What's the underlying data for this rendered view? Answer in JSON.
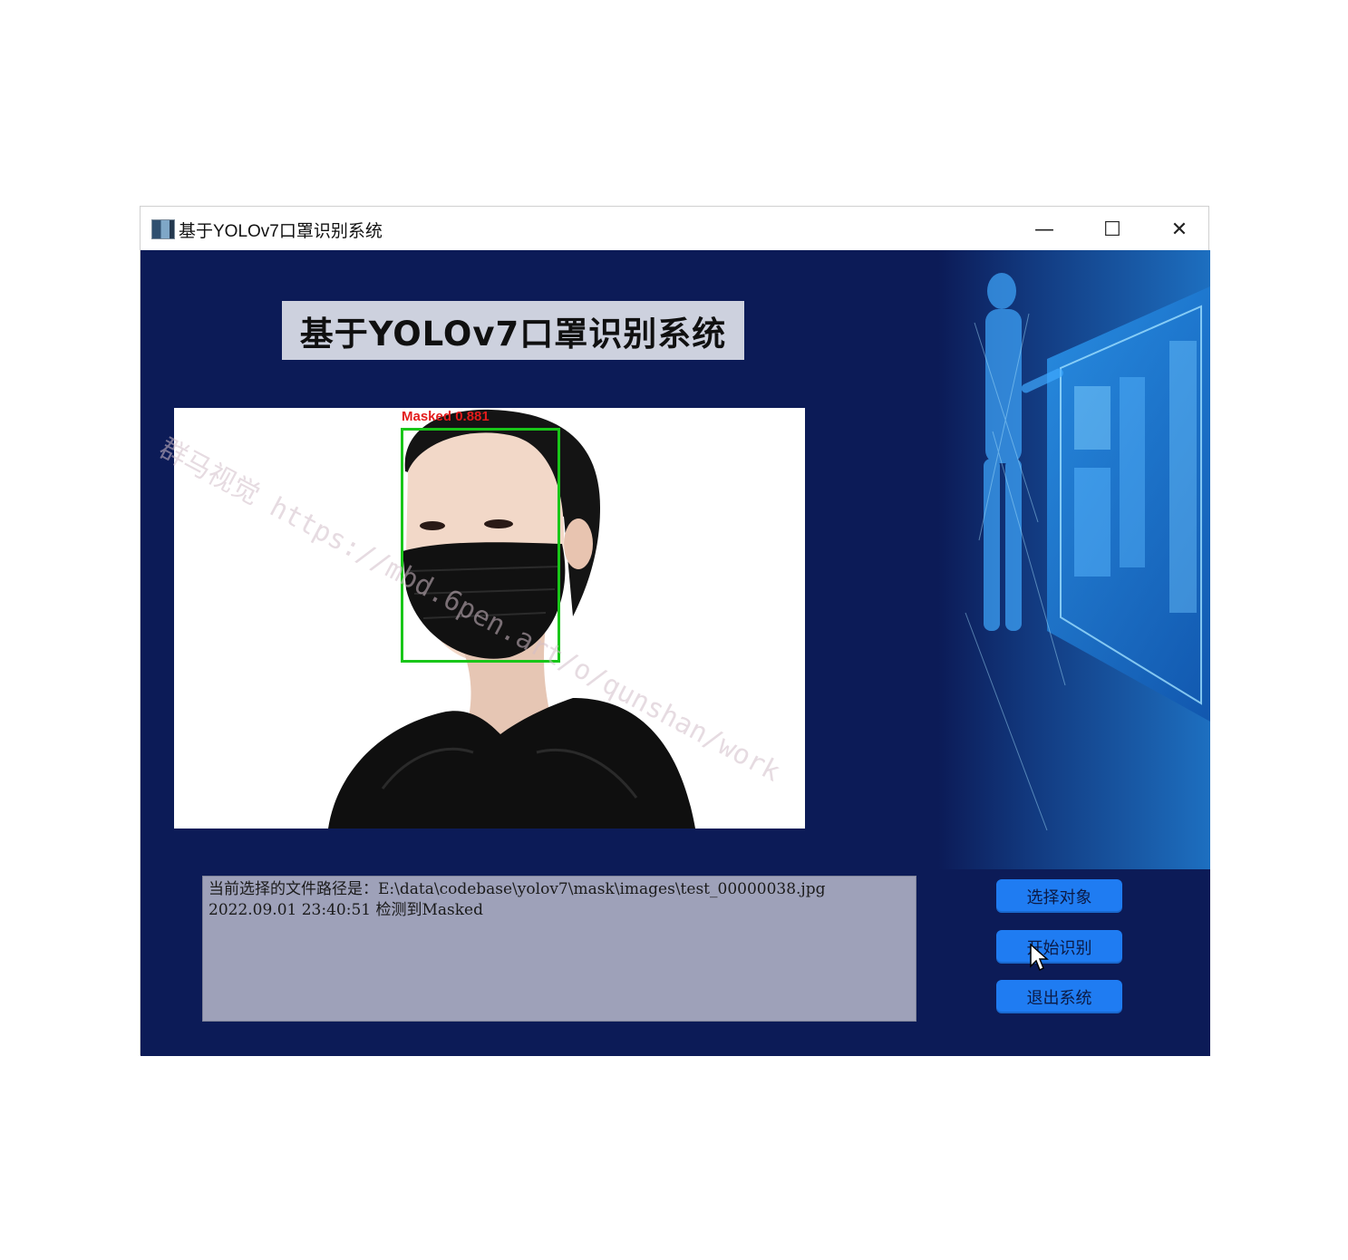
{
  "window": {
    "title": "基于YOLOv7口罩识别系统",
    "controls": {
      "minimize": "—",
      "maximize": "☐",
      "close": "✕"
    }
  },
  "header": {
    "title": "基于YOLOv7口罩识别系统"
  },
  "detection": {
    "label": "Masked 0.881",
    "box_color": "#19c619",
    "label_color": "#e31b1b"
  },
  "log": {
    "lines": [
      "当前选择的文件路径是：E:\\data\\codebase\\yolov7\\mask\\images\\test_00000038.jpg",
      "2022.09.01 23:40:51 检测到Masked"
    ]
  },
  "buttons": {
    "select": "选择对象",
    "start": "开始识别",
    "exit": "退出系统"
  },
  "watermark": "群马视觉 https://mbd.6pen.art/o/qunshan/work",
  "colors": {
    "background": "#0c1b57",
    "button": "#1f7cf2",
    "log_bg": "#9ea1b9",
    "title_bg": "#cdd1de"
  }
}
